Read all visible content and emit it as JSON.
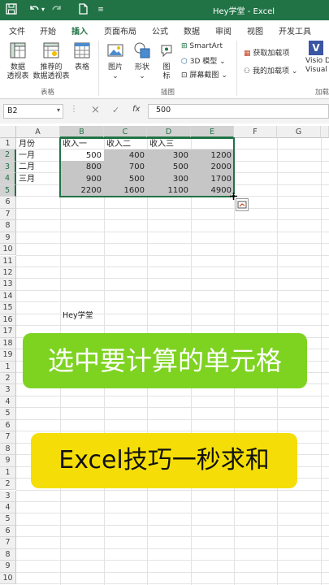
{
  "titlebar": {
    "title": "Hey学堂 - Excel",
    "accent": "#217346"
  },
  "quick_access": {
    "save_icon": "save-icon",
    "undo_icon": "undo-icon",
    "redo_icon": "redo-icon",
    "new_icon": "new-file-icon",
    "customize_icon": "customize-icon"
  },
  "tabs": [
    {
      "label": "文件"
    },
    {
      "label": "开始"
    },
    {
      "label": "插入",
      "active": true
    },
    {
      "label": "页面布局"
    },
    {
      "label": "公式"
    },
    {
      "label": "数据"
    },
    {
      "label": "审阅"
    },
    {
      "label": "视图"
    },
    {
      "label": "开发工具"
    }
  ],
  "ribbon": {
    "pivot_table": "数据\n透视表",
    "pivot_table_l1": "数据",
    "pivot_table_l2": "透视表",
    "recommended_pivot_l1": "推荐的",
    "recommended_pivot_l2": "数据透视表",
    "table": "表格",
    "group_tables": "表格",
    "pictures": "图片",
    "shapes": "形状",
    "icons_l1": "图",
    "icons_l2": "标",
    "smartart": "SmartArt",
    "model_3d": "3D 模型",
    "screenshot": "屏幕截图",
    "group_illustrations": "插图",
    "get_addins": "获取加载项",
    "my_addins": "我的加载项",
    "visio_l1": "Visio D",
    "visio_l2": "Visual",
    "group_addins": "加载"
  },
  "formula_bar": {
    "name_box": "B2",
    "cancel_icon": "×",
    "enter_icon": "✓",
    "fx_label": "fx",
    "value": "500"
  },
  "columns": [
    "A",
    "B",
    "C",
    "D",
    "E",
    "F",
    "G"
  ],
  "rows": [
    "1",
    "2",
    "3",
    "4",
    "5",
    "6",
    "7",
    "8",
    "9",
    "10",
    "11",
    "12",
    "13",
    "14",
    "15",
    "16",
    "17",
    "18",
    "19",
    "1",
    "2",
    "3",
    "4",
    "5",
    "6",
    "7",
    "8",
    "9",
    "1",
    "2",
    "3",
    "4",
    "5",
    "6",
    "7",
    "8",
    "9",
    "10"
  ],
  "sheet": {
    "A1": "月份",
    "B1": "收入一",
    "C1": "收入二",
    "D1": "收入三",
    "A2": "一月",
    "A3": "二月",
    "A4": "三月",
    "B2": "500",
    "C2": "400",
    "D2": "300",
    "E2": "1200",
    "B3": "800",
    "C3": "700",
    "D3": "500",
    "E3": "2000",
    "B4": "900",
    "C4": "500",
    "D4": "300",
    "E4": "1700",
    "B5": "2200",
    "C5": "1600",
    "D5": "1100",
    "E5": "4900",
    "B16": "Hey学堂"
  },
  "banners": {
    "select_cells": "选中要计算的单元格",
    "excel_tip": "Excel技巧一秒求和",
    "green": "#7ed321",
    "yellow": "#f5de07"
  }
}
